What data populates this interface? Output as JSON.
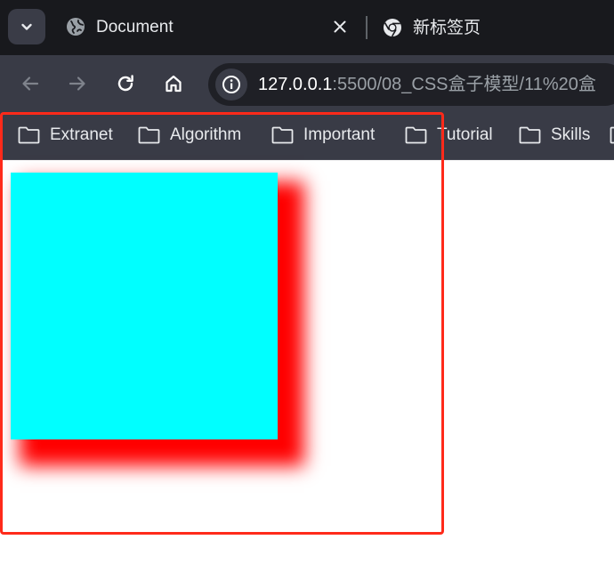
{
  "browser": {
    "tabs": [
      {
        "title": "Document",
        "icon": "globe-icon",
        "active": true
      },
      {
        "title": "新标签页",
        "icon": "chrome-icon",
        "active": false
      }
    ],
    "url": {
      "host": "127.0.0.1",
      "path": ":5500/08_CSS盒子模型/11%20盒"
    },
    "bookmarks": [
      {
        "label": "Extranet"
      },
      {
        "label": "Algorithm"
      },
      {
        "label": "Important"
      },
      {
        "label": "Tutorial"
      },
      {
        "label": "Skills"
      }
    ]
  },
  "page": {
    "box_color": "#00ffff",
    "shadow_color": "#ff0000",
    "annotation_color": "#ff2a1a"
  },
  "theme": {
    "tabstrip_bg": "#18191d",
    "toolbar_bg": "#393b46",
    "omnibox_bg": "#1f2026",
    "text": "#e8eaed",
    "muted_text": "#9aa0a6"
  }
}
